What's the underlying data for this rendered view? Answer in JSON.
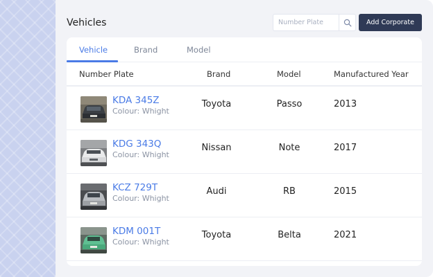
{
  "page": {
    "title": "Vehicles"
  },
  "search": {
    "placeholder": "Number Plate",
    "value": ""
  },
  "actions": {
    "add_label": "Add Corporate"
  },
  "tabs": [
    {
      "label": "Vehicle",
      "active": true
    },
    {
      "label": "Brand",
      "active": false
    },
    {
      "label": "Model",
      "active": false
    }
  ],
  "table": {
    "headers": [
      "Number Plate",
      "Brand",
      "Model",
      "Manufactured Year"
    ],
    "rows": [
      {
        "plate": "KDA 345Z",
        "colour": "Colour: Whight",
        "brand": "Toyota",
        "model": "Passo",
        "year": "2013",
        "thumb_icon": "car-photo-dark"
      },
      {
        "plate": "KDG 343Q",
        "colour": "Colour: Whight",
        "brand": "Nissan",
        "model": "Note",
        "year": "2017",
        "thumb_icon": "car-photo-white"
      },
      {
        "plate": "KCZ 729T",
        "colour": "Colour: Whight",
        "brand": "Audi",
        "model": "RB",
        "year": "2015",
        "thumb_icon": "car-photo-silver"
      },
      {
        "plate": "KDM 001T",
        "colour": "Colour: Whight",
        "brand": "Toyota",
        "model": "Belta",
        "year": "2021",
        "thumb_icon": "car-photo-green"
      }
    ]
  },
  "colors": {
    "accent": "#4a7be6",
    "primary_button": "#2f3a56",
    "sidebar_pattern": "#c9d2ef",
    "panel_bg": "#f2f3f7"
  }
}
